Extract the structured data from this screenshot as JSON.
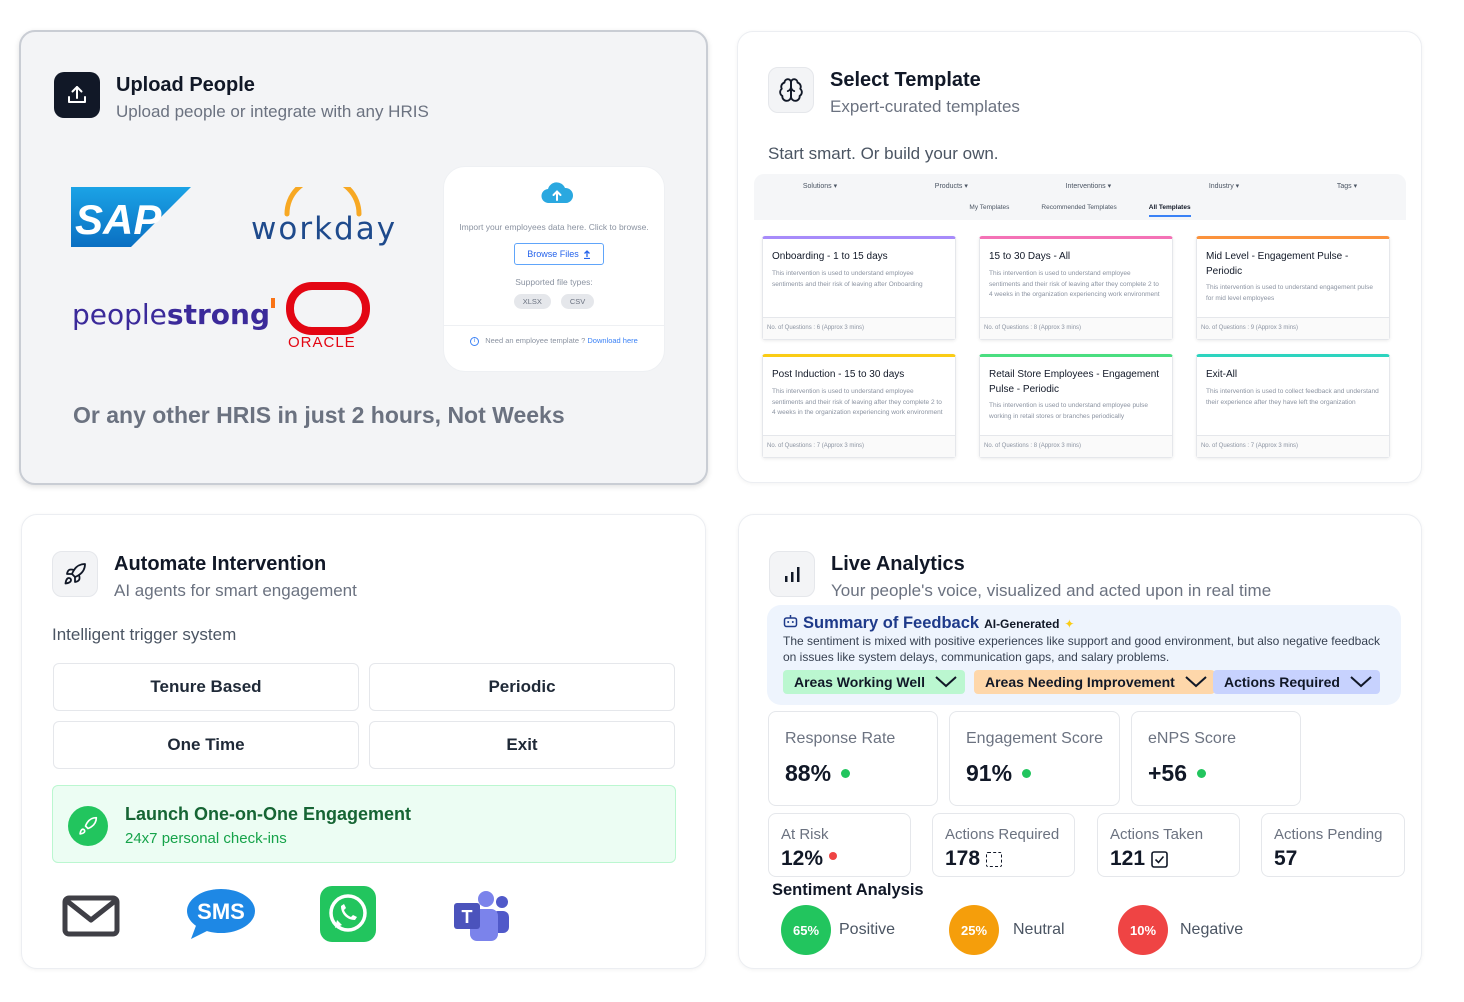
{
  "upload": {
    "title": "Upload People",
    "subtitle": "Upload people or integrate with any HRIS",
    "logos": {
      "sap": "SAP",
      "workday": "workday",
      "peoplestrong_a": "people",
      "peoplestrong_b": "strong",
      "oracle": "ORACLE"
    },
    "dropzone": {
      "prompt": "Import your employees data here. Click to browse.",
      "browse_label": "Browse Files",
      "types_label": "Supported file types:",
      "types": [
        "XLSX",
        "CSV"
      ],
      "footer_text": "Need an employee template ?",
      "footer_link": "Download here"
    },
    "footer": "Or any other HRIS in just 2 hours, Not Weeks"
  },
  "template": {
    "title": "Select Template",
    "subtitle": "Expert-curated templates",
    "lead": "Start smart. Or build your own.",
    "filters": [
      "Solutions ▾",
      "Products ▾",
      "Interventions ▾",
      "Industry ▾",
      "Tags ▾"
    ],
    "tabs": [
      "My Templates",
      "Recommended Templates",
      "All Templates"
    ],
    "cards": [
      {
        "title": "Onboarding - 1 to 15 days",
        "desc": "This intervention is used to understand employee sentiments and their risk of leaving after Onboarding",
        "footer": "No. of Questions : 6 (Approx 3 mins)",
        "color": "#a78bfa"
      },
      {
        "title": "15 to 30 Days - All",
        "desc": "This intervention is used to understand employee sentiments and their risk of leaving after they complete 2 to 4 weeks in the organization experiencing work environment",
        "footer": "No. of Questions : 8 (Approx 3 mins)",
        "color": "#f472b6"
      },
      {
        "title": "Mid Level - Engagement Pulse - Periodic",
        "desc": "This intervention is used to understand engagement pulse for mid level employees",
        "footer": "No. of Questions : 9 (Approx 3 mins)",
        "color": "#fb923c"
      },
      {
        "title": "Post Induction - 15 to 30 days",
        "desc": "This intervention is used to understand employee sentiments and their risk of leaving after they complete 2 to 4 weeks in the organization experiencing work environment",
        "footer": "No. of Questions : 7 (Approx 3 mins)",
        "color": "#facc15"
      },
      {
        "title": "Retail Store Employees - Engagement Pulse - Periodic",
        "desc": "This intervention is used to understand employee pulse working in retail stores or branches periodically",
        "footer": "No. of Questions : 8 (Approx 3 mins)",
        "color": "#4ade80"
      },
      {
        "title": "Exit-All",
        "desc": "This intervention is used to collect feedback and understand their experience after they have left the organization",
        "footer": "No. of Questions : 7 (Approx 3 mins)",
        "color": "#2dd4bf"
      }
    ]
  },
  "automate": {
    "title": "Automate Intervention",
    "subtitle": "AI agents for smart engagement",
    "lead": "Intelligent trigger system",
    "triggers": [
      "Tenure Based",
      "Periodic",
      "One Time",
      "Exit"
    ],
    "launch_title": "Launch One-on-One Engagement",
    "launch_sub": "24x7 personal check-ins",
    "channels": [
      "email-icon",
      "sms-icon",
      "whatsapp-icon",
      "teams-icon"
    ],
    "sms_text": "SMS"
  },
  "analytics": {
    "title": "Live Analytics",
    "subtitle": "Your people's voice, visualized and acted upon in real time",
    "summary_title": "Summary of Feedback",
    "summary_badge": "AI-Generated",
    "summary_text": "The sentiment is mixed with positive experiences like support and good environment, but also negative feedback on issues like system delays, communication gaps, and salary problems.",
    "pills": [
      {
        "label": "Areas Working Well",
        "color": "#bbf7d0"
      },
      {
        "label": "Areas Needing Improvement",
        "color": "#fed7aa"
      },
      {
        "label": "Actions Required",
        "color": "#c7d2fe"
      }
    ],
    "metrics": [
      {
        "label": "Response Rate",
        "value": "88%",
        "status": "#22c55e"
      },
      {
        "label": "Engagement Score",
        "value": "91%",
        "status": "#22c55e"
      },
      {
        "label": "eNPS Score",
        "value": "+56",
        "status": "#22c55e"
      }
    ],
    "small_metrics": [
      {
        "label": "At Risk",
        "value": "12%",
        "icon": "red-dot-icon"
      },
      {
        "label": "Actions Required",
        "value": "178",
        "icon": "dashed-box-icon"
      },
      {
        "label": "Actions Taken",
        "value": "121",
        "icon": "checkbox-icon"
      },
      {
        "label": "Actions Pending",
        "value": "57",
        "icon": ""
      }
    ],
    "sentiment_title": "Sentiment Analysis",
    "sentiment": [
      {
        "pct": "65%",
        "label": "Positive",
        "color": "#22c55e"
      },
      {
        "pct": "25%",
        "label": "Neutral",
        "color": "#f59e0b"
      },
      {
        "pct": "10%",
        "label": "Negative",
        "color": "#ef4444"
      }
    ]
  }
}
